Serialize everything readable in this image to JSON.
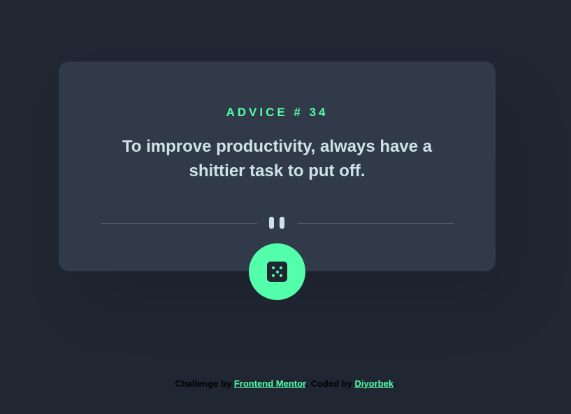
{
  "card": {
    "advice_label": "ADVICE # 34",
    "advice_text": "To improve productivity, always have a shittier task to put off."
  },
  "icons": {
    "divider": "pause-icon",
    "generate": "dice-icon"
  },
  "footer": {
    "prefix": "Challenge by",
    "challenge_link": "Frontend Mentor",
    "middle": ". Coded by",
    "author_link": "Diyorbek",
    "suffix": "."
  },
  "colors": {
    "background": "#202733",
    "card": "#313a48",
    "accent": "#53ffaa",
    "text": "#cee3e9",
    "divider": "#4f5d74"
  }
}
